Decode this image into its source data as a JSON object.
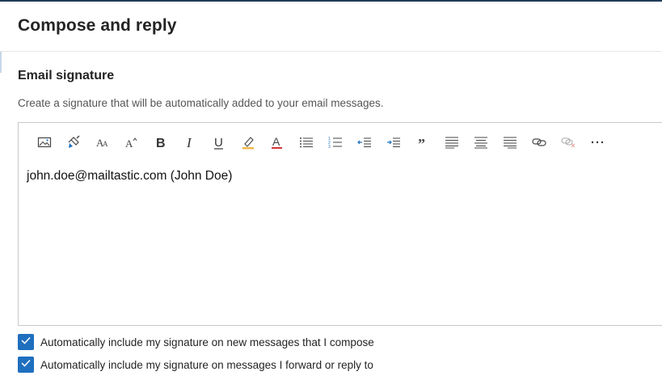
{
  "header": {
    "title": "Compose and reply"
  },
  "signature": {
    "title": "Email signature",
    "description": "Create a signature that will be automatically added to your email messages.",
    "content": "john.doe@mailtastic.com (John Doe)"
  },
  "toolbar": {
    "items": [
      {
        "icon": "insert-picture-icon"
      },
      {
        "icon": "format-painter-icon"
      },
      {
        "icon": "font-size-icon"
      },
      {
        "icon": "increase-font-size-icon"
      },
      {
        "icon": "bold-icon"
      },
      {
        "icon": "italic-icon"
      },
      {
        "icon": "underline-icon"
      },
      {
        "icon": "highlight-icon"
      },
      {
        "icon": "font-color-icon"
      },
      {
        "icon": "bullets-icon"
      },
      {
        "icon": "numbering-icon"
      },
      {
        "icon": "decrease-indent-icon"
      },
      {
        "icon": "increase-indent-icon"
      },
      {
        "icon": "quote-icon"
      },
      {
        "icon": "align-left-icon"
      },
      {
        "icon": "align-center-icon"
      },
      {
        "icon": "align-right-icon"
      },
      {
        "icon": "insert-link-icon"
      },
      {
        "icon": "remove-link-icon"
      },
      {
        "icon": "more-options-icon"
      }
    ]
  },
  "options": {
    "new_messages": {
      "label": "Automatically include my signature on new messages that I compose",
      "checked": true
    },
    "forward_reply": {
      "label": "Automatically include my signature on messages I forward or reply to",
      "checked": true
    }
  },
  "colors": {
    "accent": "#1f6fbf",
    "top_bar": "#1f3b57",
    "highlight": "#f2b84b",
    "font_color": "#d13438"
  }
}
